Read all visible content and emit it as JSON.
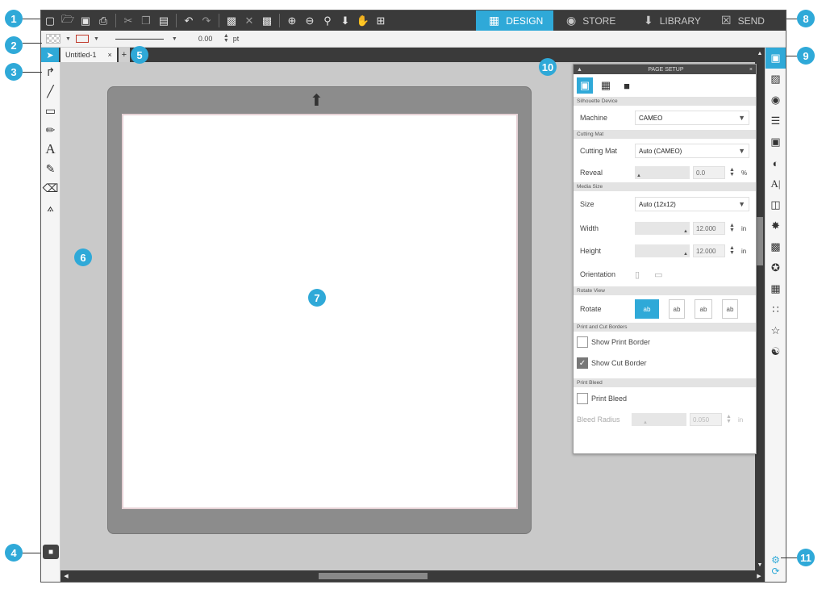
{
  "callouts": [
    "1",
    "2",
    "3",
    "4",
    "5",
    "6",
    "7",
    "8",
    "9",
    "10",
    "11"
  ],
  "toolbar": {
    "icons": [
      "new-document",
      "open-folder",
      "save",
      "print",
      "cut",
      "copy",
      "paste",
      "undo",
      "redo",
      "group",
      "ungroup",
      "compound",
      "zoom-in",
      "zoom-out",
      "zoom-fit",
      "move",
      "pan",
      "fit-page"
    ]
  },
  "app_tabs": [
    {
      "label": "DESIGN",
      "icon": "grid"
    },
    {
      "label": "STORE",
      "icon": "globe"
    },
    {
      "label": "LIBRARY",
      "icon": "download"
    },
    {
      "label": "SEND",
      "icon": "cutter"
    }
  ],
  "options": {
    "line_width": "0.00",
    "unit": "pt"
  },
  "doc_tab": {
    "label": "Untitled-1",
    "close": "×",
    "add": "+"
  },
  "page_setup": {
    "title": "PAGE SETUP",
    "close": "×",
    "silhouette_device": "Silhouette Device",
    "machine_label": "Machine",
    "machine_value": "CAMEO",
    "cutting_mat_section": "Cutting Mat",
    "cutting_mat_label": "Cutting Mat",
    "cutting_mat_value": "Auto (CAMEO)",
    "reveal_label": "Reveal",
    "reveal_value": "0.0",
    "reveal_unit": "%",
    "media_size_section": "Media Size",
    "size_label": "Size",
    "size_value": "Auto (12x12)",
    "width_label": "Width",
    "width_value": "12.000",
    "height_label": "Height",
    "height_value": "12.000",
    "length_unit": "in",
    "orientation_label": "Orientation",
    "rotate_view_section": "Rotate View",
    "rotate_label": "Rotate",
    "rotate_options": [
      "ab",
      "ab",
      "ab",
      "ab"
    ],
    "print_cut_section": "Print and Cut Borders",
    "show_print_border": "Show Print Border",
    "show_cut_border": "Show Cut Border",
    "print_bleed_section": "Print Bleed",
    "print_bleed": "Print Bleed",
    "bleed_radius_label": "Bleed Radius",
    "bleed_radius_value": "0.050"
  }
}
